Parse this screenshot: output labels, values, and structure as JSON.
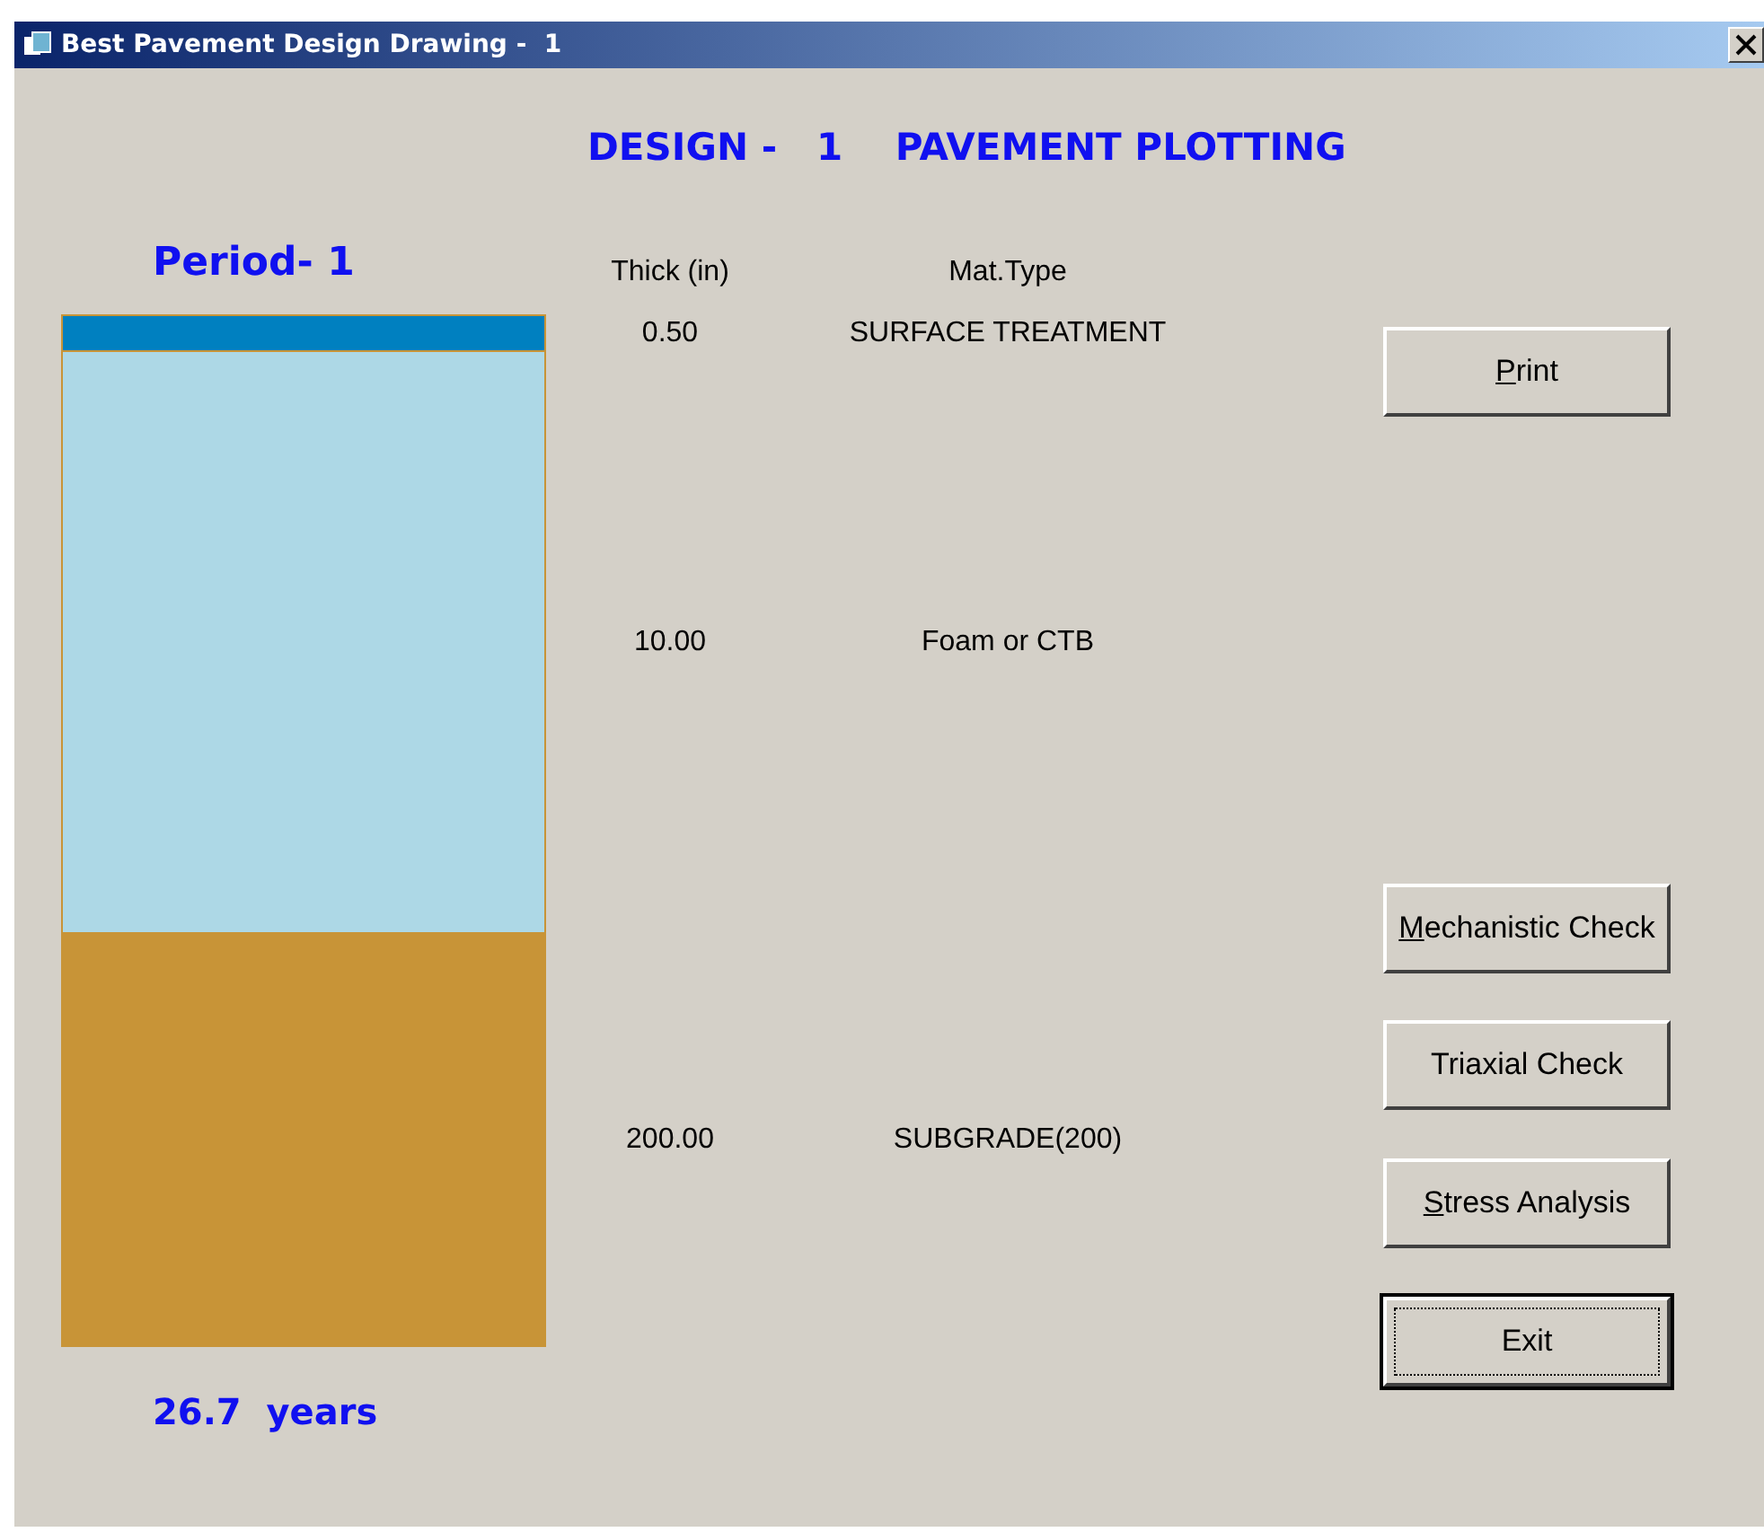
{
  "window": {
    "title": "Best Pavement Design Drawing -  1"
  },
  "heading": "DESIGN -   1    PAVEMENT PLOTTING",
  "period": "Period- 1",
  "columns": {
    "thick": "Thick (in)",
    "material": "Mat.Type"
  },
  "layers": [
    {
      "thick": "0.50",
      "material": "SURFACE TREATMENT",
      "color": "#0080c0"
    },
    {
      "thick": "10.00",
      "material": "Foam or CTB",
      "color": "#add8e6"
    },
    {
      "thick": "200.00",
      "material": "SUBGRADE(200)",
      "color": "#c89437"
    }
  ],
  "life": "26.7  years",
  "buttons": [
    {
      "label": "Print",
      "mnemonic": true,
      "focused": false
    },
    {
      "label": "Mechanistic Check",
      "mnemonic": true,
      "focused": false
    },
    {
      "label": "Triaxial Check",
      "mnemonic": false,
      "focused": false
    },
    {
      "label": "Stress Analysis",
      "mnemonic": true,
      "focused": false
    },
    {
      "label": "Exit",
      "mnemonic": false,
      "focused": true
    }
  ]
}
